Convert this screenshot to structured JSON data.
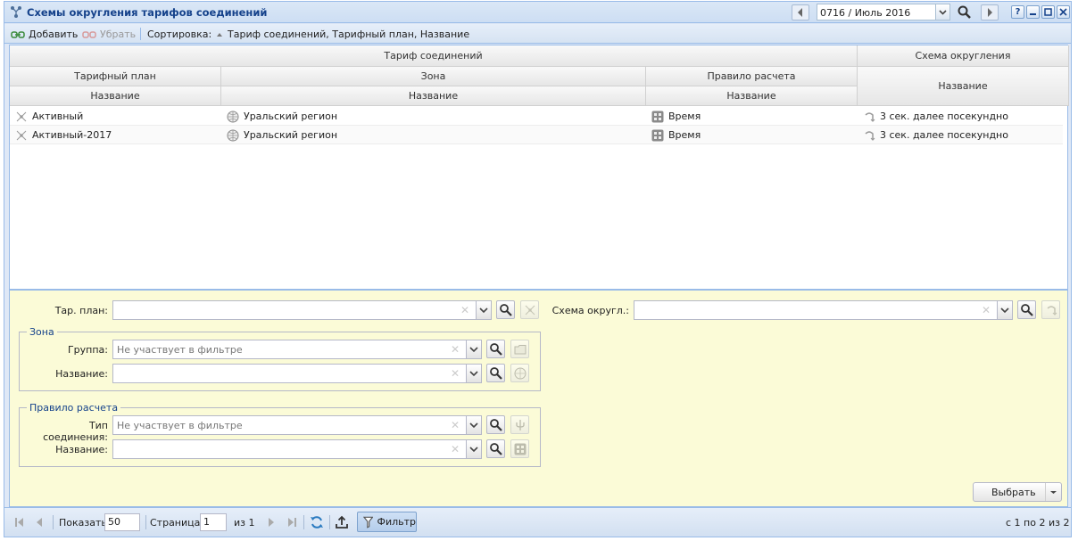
{
  "window": {
    "title": "Схемы округления тарифов соединений",
    "period": "0716 / Июль 2016"
  },
  "toolbar": {
    "add_label": "Добавить",
    "remove_label": "Убрать",
    "sort_label": "Сортировка:",
    "sort_value": "Тариф соединений, Тарифный план, Название"
  },
  "grid": {
    "group_headers": {
      "tariff": "Тариф соединений",
      "scheme": "Схема округления"
    },
    "sub_headers": {
      "plan": "Тарифный план",
      "zone": "Зона",
      "rule": "Правило расчета"
    },
    "col_headers": {
      "plan_name": "Название",
      "zone_name": "Название",
      "rule_name": "Название",
      "scheme_name": "Название"
    },
    "rows": [
      {
        "plan": "Активный",
        "zone": "Уральский регион",
        "rule": "Время",
        "scheme": "3 сек. далее посекундно"
      },
      {
        "plan": "Активный-2017",
        "zone": "Уральский регион",
        "rule": "Время",
        "scheme": "3 сек. далее посекундно"
      }
    ]
  },
  "filter": {
    "plan_label": "Тар. план:",
    "scheme_label": "Схема округл.:",
    "zone_legend": "Зона",
    "zone_group_label": "Группа:",
    "zone_group_placeholder": "Не участвует в фильтре",
    "zone_name_label": "Название:",
    "rule_legend": "Правило расчета",
    "rule_type_label": "Тип соединения:",
    "rule_type_placeholder": "Не участвует в фильтре",
    "rule_name_label": "Название:",
    "select_button": "Выбрать"
  },
  "paging": {
    "show_label": "Показать",
    "page_size": "50",
    "page_label": "Страница",
    "page": "1",
    "of_label": "из 1",
    "filter_label": "Фильтр",
    "summary": "с 1 по 2 из 2"
  }
}
